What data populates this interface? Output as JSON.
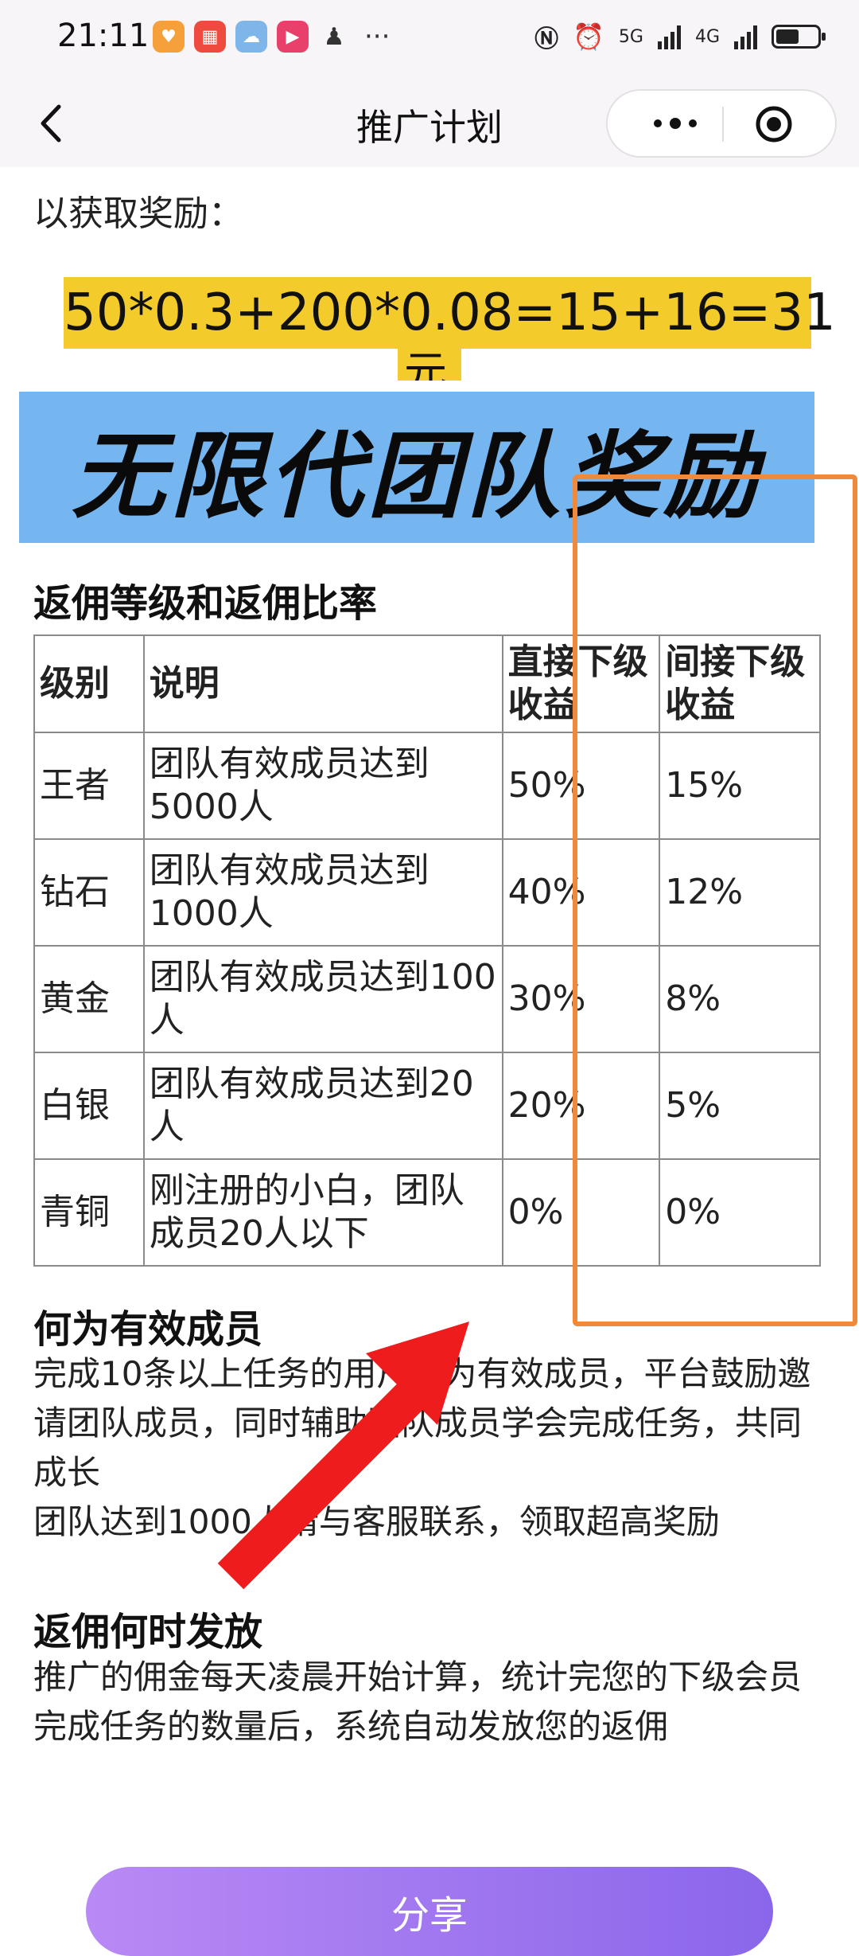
{
  "status_bar": {
    "time": "21:11",
    "dots": "···",
    "network_5g": "5G",
    "network_4g": "4G",
    "battery_level": 0.55,
    "app_icons": [
      "heart-app-icon",
      "grid-app-icon",
      "ghost-app-icon",
      "video-play-app-icon",
      "penguin-app-icon"
    ]
  },
  "nav": {
    "title": "推广计划"
  },
  "content": {
    "intro": "以获取奖励：",
    "formula": "50*0.3+200*0.08=15+16=31",
    "formula_unit": "元",
    "banner": "无限代团队奖励",
    "table_title": "返佣等级和返佣比率",
    "table": {
      "headers": [
        "级别",
        "说明",
        "直接下级收益",
        "间接下级收益"
      ],
      "rows": [
        {
          "level": "王者",
          "desc": "团队有效成员达到5000人",
          "direct": "50%",
          "indirect": "15%"
        },
        {
          "level": "钻石",
          "desc": "团队有效成员达到1000人",
          "direct": "40%",
          "indirect": "12%"
        },
        {
          "level": "黄金",
          "desc": "团队有效成员达到100人",
          "direct": "30%",
          "indirect": "8%"
        },
        {
          "level": "白银",
          "desc": "团队有效成员达到20人",
          "direct": "20%",
          "indirect": "5%"
        },
        {
          "level": "青铜",
          "desc": "刚注册的小白，团队成员20人以下",
          "direct": "0%",
          "indirect": "0%"
        }
      ]
    },
    "effective_title": "何为有效成员",
    "effective_text": "完成10条以上任务的用户即为有效成员，平台鼓励邀请团队成员，同时辅助团队成员学会完成任务，共同成长",
    "effective_text2": "团队达到1000人请与客服联系，领取超高奖励",
    "payout_title": "返佣何时发放",
    "payout_text": "推广的佣金每天凌晨开始计算，统计完您的下级会员完成任务的数量后，系统自动发放您的返佣",
    "share": "分享"
  },
  "colors": {
    "highlight": "#f3cc2c",
    "banner": "#75b6f0",
    "orange_box": "#f08a3a",
    "arrow": "#ee1c1c",
    "share_start": "#b98af5",
    "share_end": "#8a66ea"
  }
}
